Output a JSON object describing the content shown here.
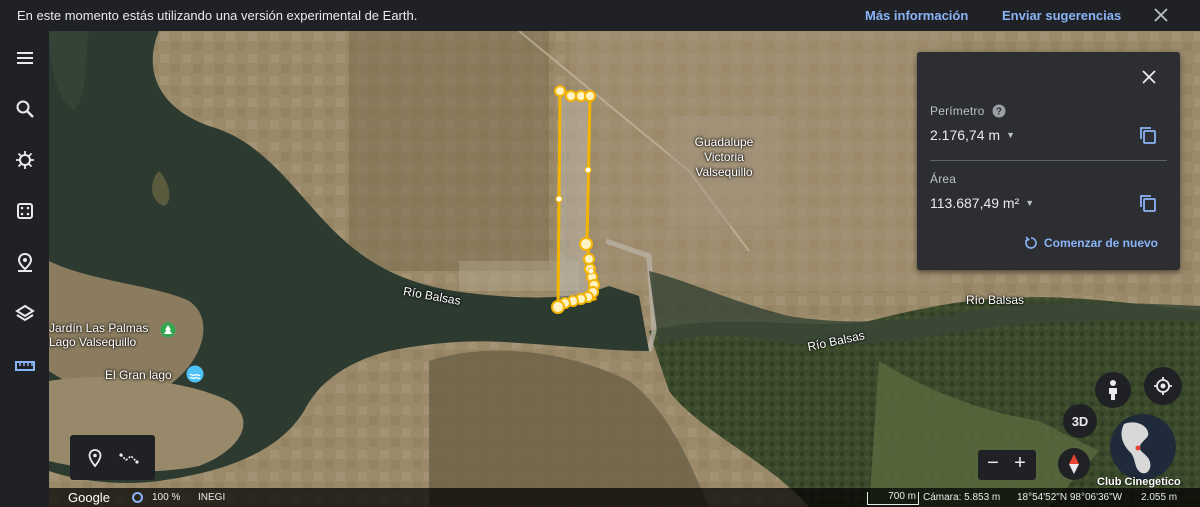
{
  "banner": {
    "message": "En este momento estás utilizando una versión experimental de Earth.",
    "more_info": "Más información",
    "feedback": "Enviar sugerencias"
  },
  "rail": {
    "icons": [
      "menu-icon",
      "search-icon",
      "voyager-icon",
      "projects-icon",
      "places-icon",
      "layers-icon",
      "measure-icon"
    ],
    "accent": "#8ab4f8"
  },
  "map": {
    "labels": {
      "rio_balsas_1": "Río Balsas",
      "rio_balsas_2": "Río Balsas",
      "rio_balsas_3": "Río Balsas",
      "town_line1": "Guadalupe",
      "town_line2": "Victoria",
      "town_line3": "Valsequillo",
      "poi_jardin_1": "Jardín Las Palmas",
      "poi_jardin_2": "Lago Valsequillo",
      "poi_gran_lago": "El Gran lago"
    },
    "measure_line_color": "#f5b400"
  },
  "panel": {
    "perimeter_label": "Perímetro",
    "perimeter_value": "2.176,74 m",
    "area_label": "Área",
    "area_value": "113.687,49 m²",
    "restart": "Comenzar de nuevo"
  },
  "controls": {
    "btn_3d": "3D",
    "zoom_out": "−",
    "zoom_in": "+",
    "watermark": "Club Cinegetico"
  },
  "status": {
    "brand": "Google",
    "stream_pct": "100 %",
    "attribution": "INEGI",
    "scale": "700 m",
    "camera": "Cámara: 5.853 m",
    "coords": "18°54'52\"N 98°06'36\"W",
    "altitude": "2.055 m"
  }
}
